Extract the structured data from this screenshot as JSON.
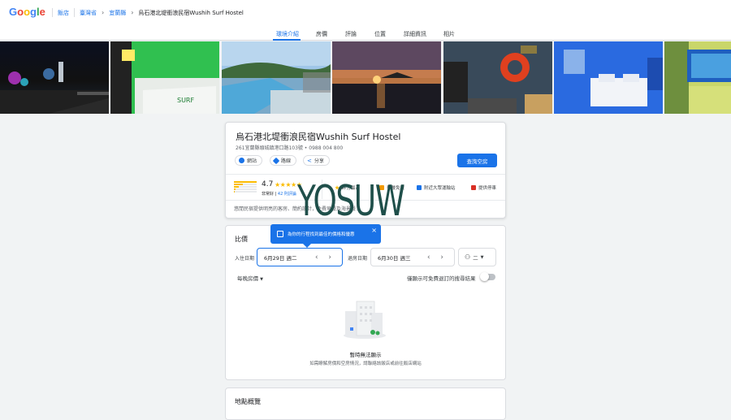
{
  "colors": {
    "accent": "#1a73e8",
    "star": "#fbbc04",
    "watermark": "#1f4f4a"
  },
  "header": {
    "logo": "Google",
    "breadcrumb": {
      "home": "飯店",
      "region": "臺灣省",
      "county": "宜蘭縣",
      "current": "烏石港北堤衝浪民宿Wushih Surf Hostel"
    }
  },
  "tabs": [
    {
      "label": "環境介紹",
      "active": true
    },
    {
      "label": "房價",
      "active": false
    },
    {
      "label": "評論",
      "active": false
    },
    {
      "label": "位置",
      "active": false
    },
    {
      "label": "詳細資訊",
      "active": false
    },
    {
      "label": "相片",
      "active": false
    }
  ],
  "photos": [
    "night-harbor-lights",
    "green-room-bed",
    "rooftop-mountain-view",
    "sunset-over-sea",
    "room-with-lifebuoy",
    "blue-bedroom",
    "surf-picture-frame"
  ],
  "hotel": {
    "name": "烏石港北堤衝浪民宿Wushih Surf Hostel",
    "address": "261宜蘭縣頭城鎮港口路103號 • 0988 004 800",
    "actions": {
      "website": "網站",
      "directions": "路線",
      "share": "分享"
    },
    "check_rooms": "查詢空房",
    "rating": "4.7",
    "stars": "★★★★★",
    "rating_word": "非常好",
    "reviews_link": "42 則評論",
    "amenities": [
      "評分最高",
      "早餐免費",
      "附近大眾運輸站",
      "提供停車"
    ],
    "description": "悠閒民宿提供明亮的客房、簡約設計，免費早餐及海景餐…"
  },
  "prices": {
    "title": "比價",
    "tooltip": "為你的行程找到最佳的價格和優惠",
    "tooltip_close": "×",
    "checkin_label": "入住日期",
    "checkin_value": "6月29日 週二",
    "checkout_label": "退房日期",
    "checkout_value": "6月30日 週三",
    "guests": "二",
    "per_night": "每晚房價",
    "free_cancel_label": "僅顯示可免費退訂的搜尋結果",
    "free_cancel_on": false,
    "empty_title": "暫時無法顯示",
    "empty_sub": "如需瞭解房價和空房情況，請聯絡該飯店或前往飯店網站"
  },
  "location": {
    "title": "地點概覽"
  },
  "watermark": "YOSUW"
}
